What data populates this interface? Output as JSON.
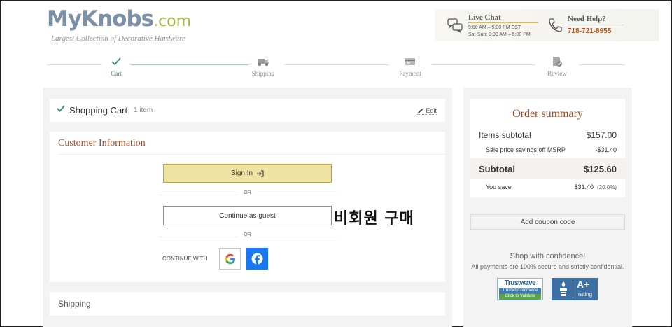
{
  "header": {
    "logo_main": "MyKnobs",
    "logo_suffix": ".com",
    "tagline": "Largest Collection of Decorative Hardware",
    "live_chat": {
      "title": "Live Chat",
      "hours_weekday": "9:00 AM – 5:00 PM EST",
      "hours_weekend": "Sat-Sun: 9:00 AM – 5:00 PM"
    },
    "help": {
      "title": "Need Help?",
      "phone": "718-721-8955"
    }
  },
  "steps": [
    {
      "label": "Cart",
      "icon": "check-icon",
      "state": "active"
    },
    {
      "label": "Shipping",
      "icon": "truck-icon",
      "state": "pending"
    },
    {
      "label": "Payment",
      "icon": "credit-card-icon",
      "state": "pending"
    },
    {
      "label": "Review",
      "icon": "review-icon",
      "state": "pending"
    }
  ],
  "cart": {
    "title": "Shopping Cart",
    "count": "1 item",
    "edit_label": "Edit"
  },
  "customer": {
    "title": "Customer Information",
    "sign_in_label": "Sign In",
    "or_label": "OR",
    "guest_label": "Continue as guest",
    "guest_annotation": "비회원 구매",
    "continue_with_label": "CONTINUE WITH"
  },
  "shipping": {
    "title": "Shipping"
  },
  "summary": {
    "title": "Order summary",
    "items_subtotal_label": "Items subtotal",
    "items_subtotal_value": "$157.00",
    "sale_label": "Sale price savings off MSRP",
    "sale_value": "-$31.40",
    "subtotal_label": "Subtotal",
    "subtotal_value": "$125.60",
    "you_save_label": "You save",
    "you_save_value": "$31.40",
    "you_save_pct": "(20.0%)",
    "coupon_label": "Add coupon code",
    "confidence_title": "Shop with confidence!",
    "confidence_note": "All payments are 100% secure and strictly confidential."
  },
  "badges": {
    "trustwave_name": "Trustwave",
    "trustwave_sub": "Trusted Commerce",
    "trustwave_click": "Click to Validate",
    "bbb_grade": "A+",
    "bbb_rating": "rating"
  },
  "colors": {
    "accent_brown": "#a04a22",
    "phone_orange": "#b3541e",
    "active_step_green": "#2e8b6a",
    "signin_yellow": "#eee3a2",
    "facebook_blue": "#1877f2"
  }
}
